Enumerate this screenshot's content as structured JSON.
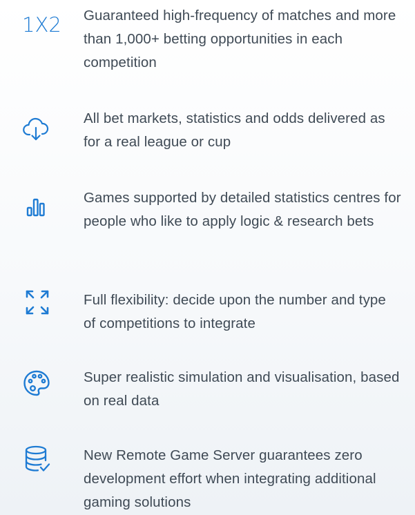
{
  "features": [
    {
      "icon": "one-x-two-icon",
      "icon_text": "1X2",
      "text": "Guaranteed high-frequency of matches and more than 1,000+ betting opportunities in each competition"
    },
    {
      "icon": "cloud-download-icon",
      "text": "All bet markets, statistics and odds delivered as for a real league or cup"
    },
    {
      "icon": "bar-chart-icon",
      "text": "Games supported by detailed statistics centres for people who like to apply logic & research bets"
    },
    {
      "icon": "expand-arrows-icon",
      "text": "Full flexibility: decide upon the number and type of competitions to integrate"
    },
    {
      "icon": "palette-icon",
      "text": "Super realistic simulation and visualisation, based on real data"
    },
    {
      "icon": "database-check-icon",
      "text": "New Remote Game Server guarantees zero development effort when integrating additional gaming solutions"
    }
  ],
  "colors": {
    "accent": "#1e7bd3",
    "text": "#3f4a55"
  }
}
